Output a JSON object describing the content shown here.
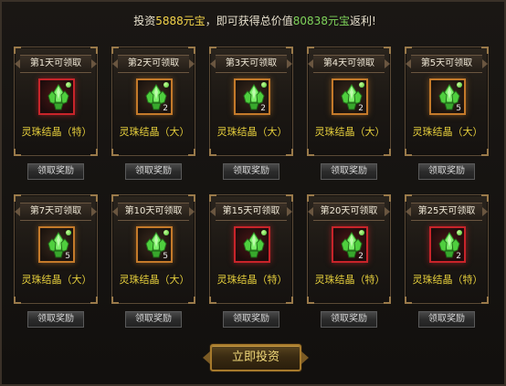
{
  "header": {
    "prefix": "投资",
    "invest_amount": "5888元宝",
    "middle": "，即可获得总价值",
    "total_value": "80838元宝",
    "suffix": "返利!"
  },
  "colors": {
    "orange_frame": "#c47a2a",
    "red_frame": "#c8242a",
    "item_name": "#e6cf3c",
    "highlight": "#f3d34a"
  },
  "item_icon": "green-crystal-icon",
  "rewards": [
    {
      "day_label": "第1天可领取",
      "item_name": "灵珠结晶（特）",
      "quantity": "",
      "frame": "red",
      "button_label": "领取奖励"
    },
    {
      "day_label": "第2天可领取",
      "item_name": "灵珠结晶（大）",
      "quantity": "2",
      "frame": "orange",
      "button_label": "领取奖励"
    },
    {
      "day_label": "第3天可领取",
      "item_name": "灵珠结晶（大）",
      "quantity": "2",
      "frame": "orange",
      "button_label": "领取奖励"
    },
    {
      "day_label": "第4天可领取",
      "item_name": "灵珠结晶（大）",
      "quantity": "2",
      "frame": "orange",
      "button_label": "领取奖励"
    },
    {
      "day_label": "第5天可领取",
      "item_name": "灵珠结晶（大）",
      "quantity": "5",
      "frame": "orange",
      "button_label": "领取奖励"
    },
    {
      "day_label": "第7天可领取",
      "item_name": "灵珠结晶（大）",
      "quantity": "5",
      "frame": "orange",
      "button_label": "领取奖励"
    },
    {
      "day_label": "第10天可领取",
      "item_name": "灵珠结晶（大）",
      "quantity": "5",
      "frame": "orange",
      "button_label": "领取奖励"
    },
    {
      "day_label": "第15天可领取",
      "item_name": "灵珠结晶（特）",
      "quantity": "",
      "frame": "red",
      "button_label": "领取奖励"
    },
    {
      "day_label": "第20天可领取",
      "item_name": "灵珠结晶（特）",
      "quantity": "2",
      "frame": "red",
      "button_label": "领取奖励"
    },
    {
      "day_label": "第25天可领取",
      "item_name": "灵珠结晶（特）",
      "quantity": "2",
      "frame": "red",
      "button_label": "领取奖励"
    }
  ],
  "invest_button": {
    "label": "立即投资"
  }
}
